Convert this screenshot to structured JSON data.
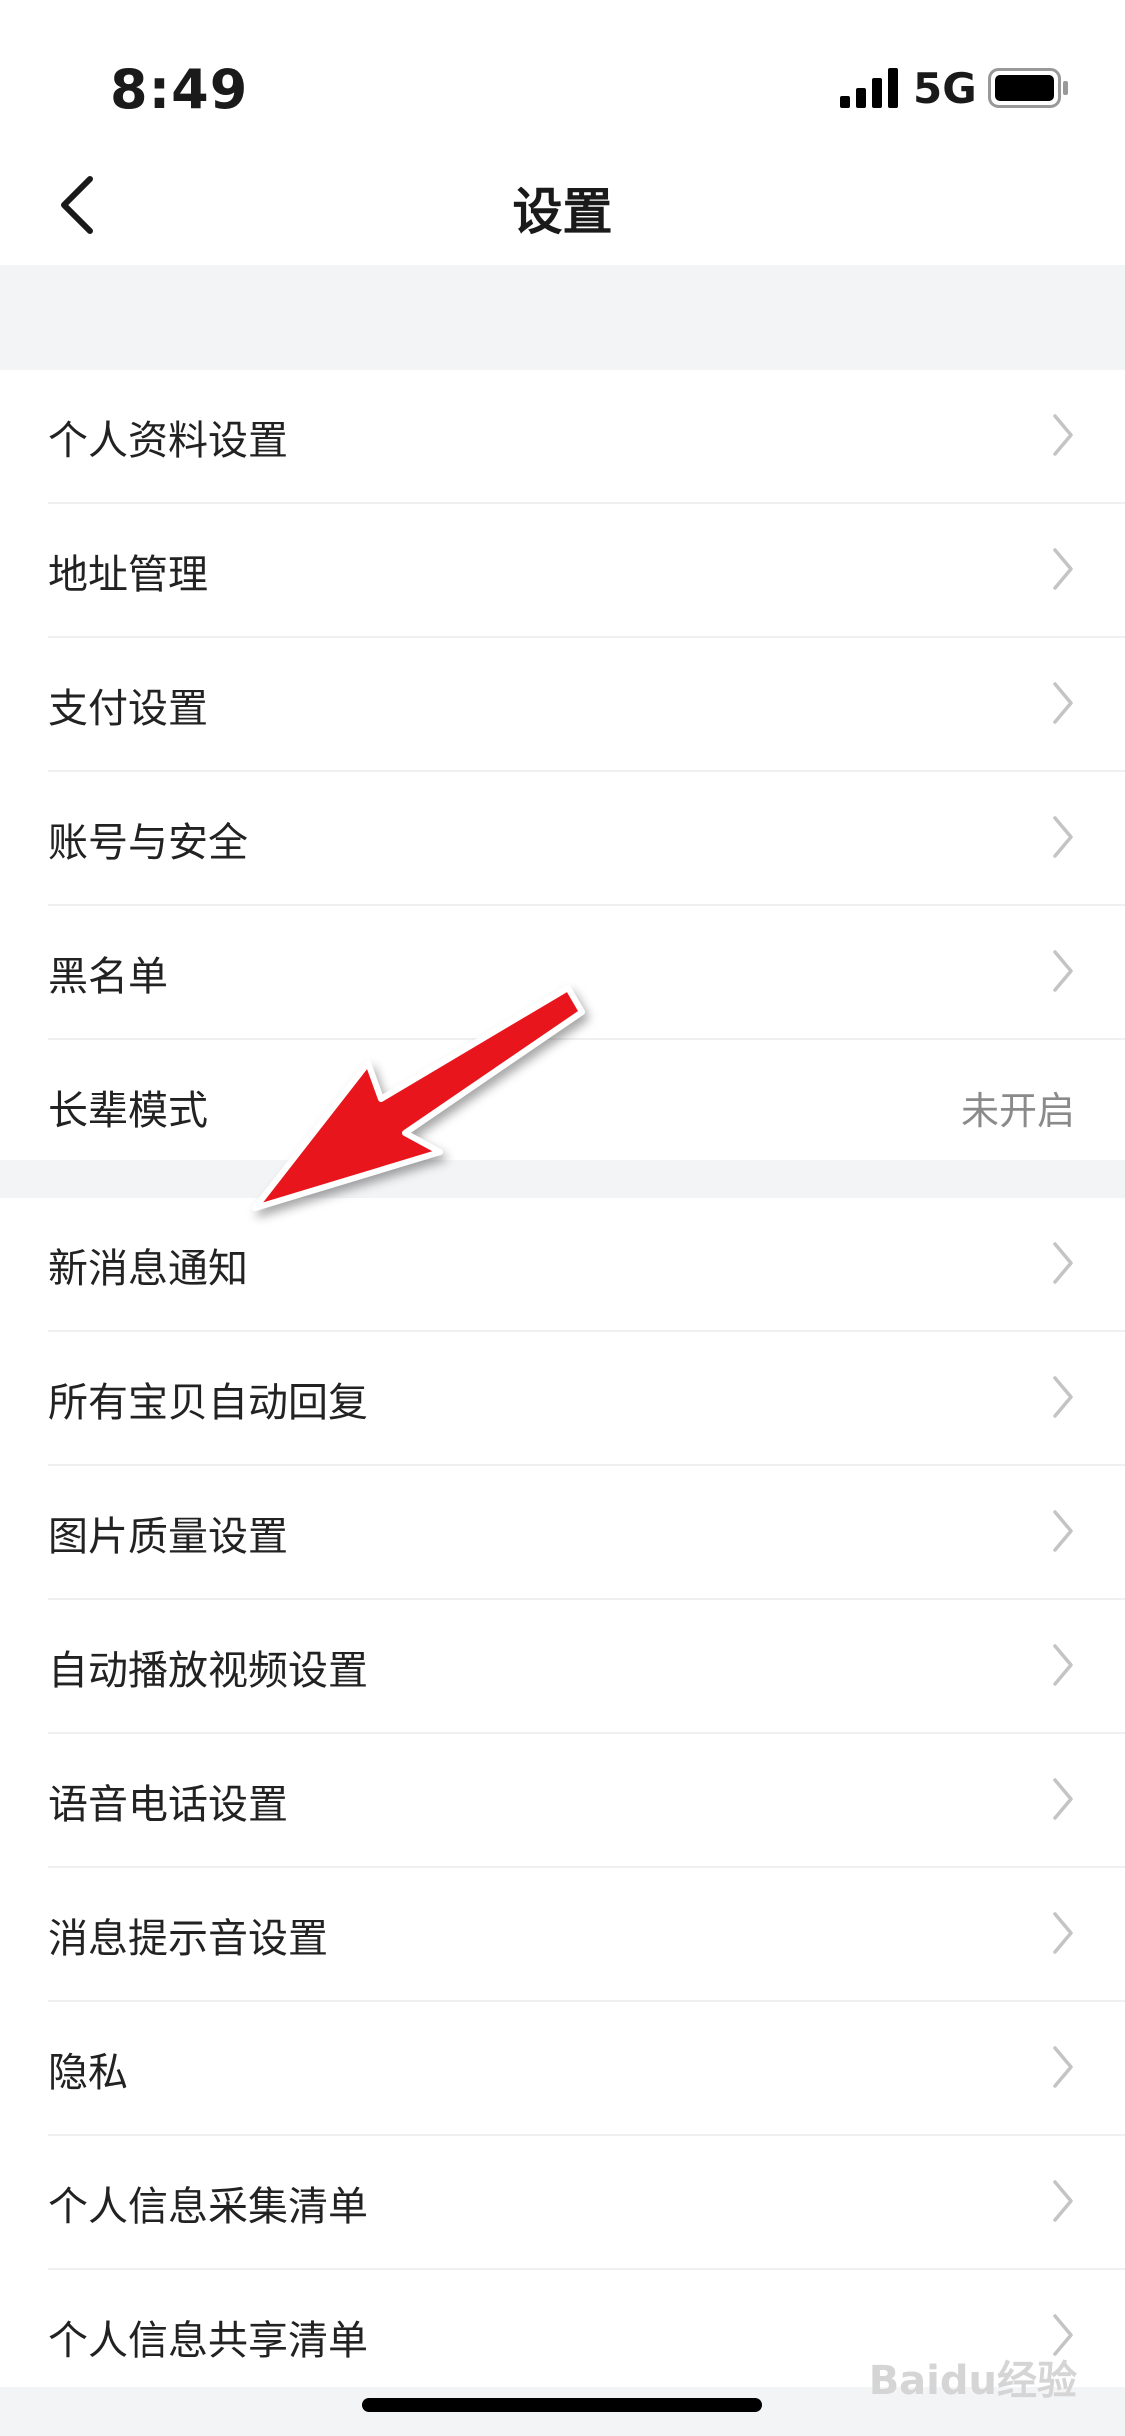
{
  "status": {
    "time": "8:49",
    "network": "5G"
  },
  "nav": {
    "title": "设置"
  },
  "group1": [
    {
      "label": "个人资料设置"
    },
    {
      "label": "地址管理"
    },
    {
      "label": "支付设置"
    },
    {
      "label": "账号与安全"
    },
    {
      "label": "黑名单"
    },
    {
      "label": "长辈模式",
      "value": "未开启"
    }
  ],
  "group2": [
    {
      "label": "新消息通知"
    },
    {
      "label": "所有宝贝自动回复"
    },
    {
      "label": "图片质量设置"
    },
    {
      "label": "自动播放视频设置"
    },
    {
      "label": "语音电话设置"
    },
    {
      "label": "消息提示音设置"
    },
    {
      "label": "隐私"
    },
    {
      "label": "个人信息采集清单"
    },
    {
      "label": "个人信息共享清单"
    }
  ],
  "watermark": {
    "text": "Baidu经验"
  },
  "colors": {
    "accent_arrow": "#e8141c",
    "section_gap": "#f3f4f6",
    "chevron": "#c4c4c4"
  }
}
